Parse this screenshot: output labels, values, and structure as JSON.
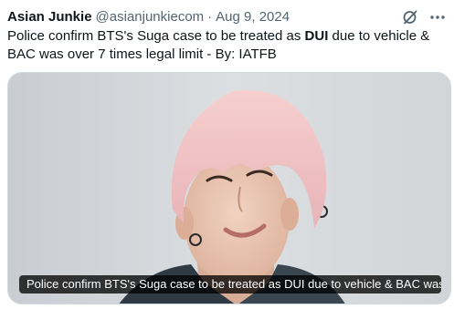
{
  "tweet": {
    "author_name": "Asian Junkie",
    "handle": "@asianjunkiecom",
    "separator": "·",
    "date": "Aug 9, 2024",
    "text_before": "Police confirm BTS's Suga case to be treated as ",
    "text_bold": "DUI",
    "text_after": " due to vehicle & BAC was over 7 times legal limit - By: IATFB"
  },
  "media": {
    "caption": "Police confirm BTS's Suga case to be treated as DUI due to vehicle & BAC was ..."
  },
  "icons": {
    "grok": "grok-icon",
    "more": "more-icon"
  },
  "colors": {
    "text_primary": "#0f1419",
    "text_secondary": "#536471",
    "border": "#cfd9de"
  }
}
